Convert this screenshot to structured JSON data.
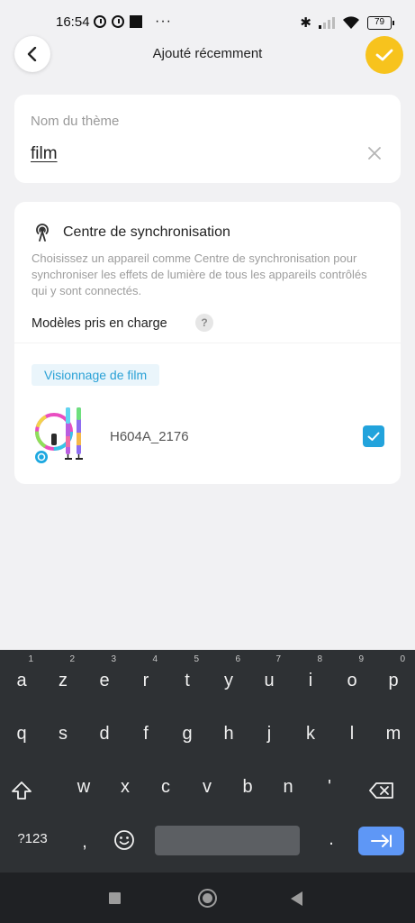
{
  "status_bar": {
    "time": "16:54",
    "battery": "79",
    "dots": "···"
  },
  "header": {
    "title": "Ajouté récemment",
    "back_icon": "chevron-left-icon",
    "confirm_icon": "check-icon",
    "accent_color": "#f7c31d"
  },
  "theme_name": {
    "label": "Nom du thème",
    "value": "film"
  },
  "sync_center": {
    "title": "Centre de synchronisation",
    "description": "Choisissez un appareil comme Centre de synchronisation pour synchroniser les effets de lumière de tous les appareils contrôlés qui y sont connectés.",
    "models_label": "Modèles pris en charge",
    "help_label": "?",
    "chip_label": "Visionnage de film",
    "device": {
      "name": "H604A_2176",
      "checked": true
    },
    "check_color": "#22a3dc"
  },
  "keyboard": {
    "row1": [
      {
        "k": "a",
        "n": "1"
      },
      {
        "k": "z",
        "n": "2"
      },
      {
        "k": "e",
        "n": "3"
      },
      {
        "k": "r",
        "n": "4"
      },
      {
        "k": "t",
        "n": "5"
      },
      {
        "k": "y",
        "n": "6"
      },
      {
        "k": "u",
        "n": "7"
      },
      {
        "k": "i",
        "n": "8"
      },
      {
        "k": "o",
        "n": "9"
      },
      {
        "k": "p",
        "n": "0"
      }
    ],
    "row2": [
      "q",
      "s",
      "d",
      "f",
      "g",
      "h",
      "j",
      "k",
      "l",
      "m"
    ],
    "row3": [
      "w",
      "x",
      "c",
      "v",
      "b",
      "n",
      "'"
    ],
    "symbols_label": "?123",
    "comma": ",",
    "period": "."
  }
}
